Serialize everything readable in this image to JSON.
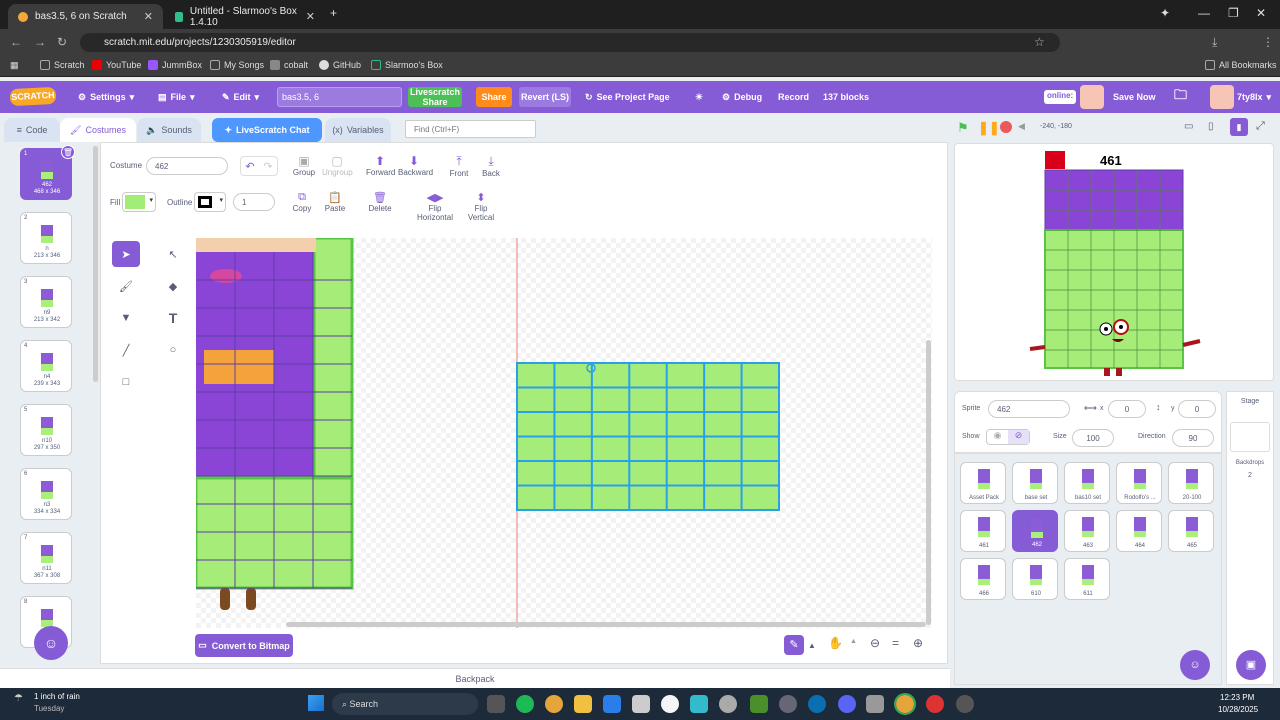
{
  "browser": {
    "tabs": [
      {
        "title": "bas3.5, 6 on Scratch"
      },
      {
        "title": "Untitled - Slarmoo's Box 1.4.10"
      }
    ],
    "url": "scratch.mit.edu/projects/1230305919/editor",
    "bookmarks": [
      "Scratch",
      "YouTube",
      "JummBox",
      "My Songs",
      "cobalt",
      "GitHub",
      "Slarmoo's Box"
    ],
    "all_bookmarks": "All Bookmarks"
  },
  "menubar": {
    "settings": "Settings",
    "file": "File",
    "edit": "Edit",
    "project_title": "bas3.5, 6",
    "livescratch_share": "Livescratch Share",
    "share": "Share",
    "revert": "Revert (LS)",
    "see_project": "See Project Page",
    "debug": "Debug",
    "record": "Record",
    "blocks_count": "137 blocks",
    "online": "online:",
    "save_now": "Save Now",
    "username": "7ty8lx"
  },
  "tabs": {
    "code": "Code",
    "costumes": "Costumes",
    "sounds": "Sounds",
    "chat": "LiveScratch Chat",
    "variables": "Variables",
    "find_placeholder": "Find (Ctrl+F)"
  },
  "paint": {
    "costume_label": "Costume",
    "costume_name": "462",
    "group": "Group",
    "ungroup": "Ungroup",
    "forward": "Forward",
    "backward": "Backward",
    "front": "Front",
    "back": "Back",
    "fill": "Fill",
    "fill_color": "#a2ed78",
    "outline": "Outline",
    "outline_width": "1",
    "copy": "Copy",
    "paste": "Paste",
    "delete": "Delete",
    "flip_h": "Flip Horizontal",
    "flip_v": "Flip Vertical",
    "convert": "Convert to Bitmap"
  },
  "costumes": [
    {
      "num": "1",
      "name": "462",
      "size": "468 x 346"
    },
    {
      "num": "2",
      "name": "n",
      "size": "213 x 346"
    },
    {
      "num": "3",
      "name": "n9",
      "size": "213 x 342"
    },
    {
      "num": "4",
      "name": "n4",
      "size": "239 x 343"
    },
    {
      "num": "5",
      "name": "n10",
      "size": "297 x 350"
    },
    {
      "num": "6",
      "name": "n3",
      "size": "334 x 334"
    },
    {
      "num": "7",
      "name": "n11",
      "size": "367 x 308"
    },
    {
      "num": "8",
      "name": "",
      "size": ""
    }
  ],
  "stage": {
    "coords": "-240, -180",
    "label_461": "461"
  },
  "sprite": {
    "label": "Sprite",
    "name": "462",
    "x_label": "x",
    "x": "0",
    "y_label": "y",
    "y": "0",
    "show": "Show",
    "size_label": "Size",
    "size": "100",
    "direction_label": "Direction",
    "direction": "90"
  },
  "sprites": [
    "Asset Pack",
    "base set",
    "bas10 set",
    "Rodolfo's ...",
    "20-100",
    "461",
    "462",
    "463",
    "464",
    "465",
    "466",
    "610",
    "611"
  ],
  "stage_panel": {
    "title": "Stage",
    "backdrops": "Backdrops",
    "count": "2"
  },
  "backpack": "Backpack",
  "taskbar": {
    "weather": "1 inch of rain",
    "day": "Tuesday",
    "search": "Search",
    "time": "12:23 PM",
    "date": "10/28/2025"
  }
}
